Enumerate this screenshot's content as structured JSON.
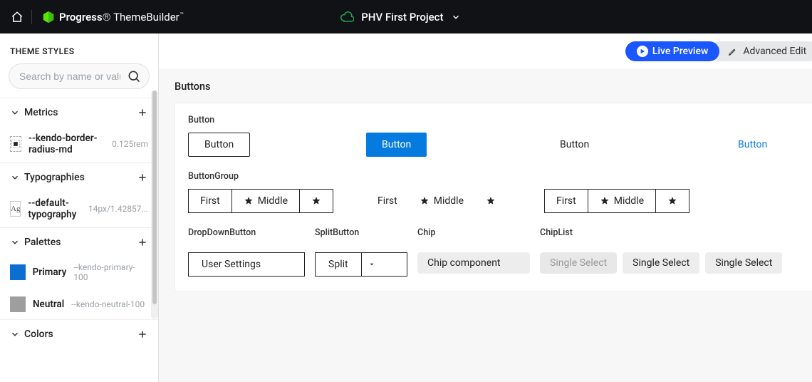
{
  "brand": {
    "company": "Progress",
    "product": "ThemeBuilder"
  },
  "project_name": "PHV First Project",
  "sidebar": {
    "title": "THEME STYLES",
    "search_placeholder": "Search by name or value",
    "sections": {
      "metrics": {
        "label": "Metrics",
        "items": [
          {
            "name": "--kendo-border-radius-md",
            "value": "0.125rem"
          }
        ]
      },
      "typographies": {
        "label": "Typographies",
        "items": [
          {
            "name": "--default-typography",
            "value": "14px/1.42857..."
          }
        ]
      },
      "palettes": {
        "label": "Palettes",
        "items": [
          {
            "name": "Primary",
            "token": "--kendo-primary-100"
          },
          {
            "name": "Neutral",
            "token": "--kendo-neutral-100"
          }
        ]
      },
      "colors": {
        "label": "Colors"
      }
    }
  },
  "toolbar": {
    "live_preview": "Live Preview",
    "advanced_edit": "Advanced Edit"
  },
  "canvas": {
    "section": "Buttons",
    "button_row": {
      "label": "Button",
      "text": "Button"
    },
    "button_group": {
      "label": "ButtonGroup",
      "first": "First",
      "middle": "Middle"
    },
    "dropdown": {
      "label": "DropDownButton",
      "text": "User Settings"
    },
    "split": {
      "label": "SplitButton",
      "text": "Split"
    },
    "chip": {
      "label": "Chip",
      "text": "Chip component"
    },
    "chiplist": {
      "label": "ChipList",
      "items": [
        "Single Select",
        "Single Select",
        "Single Select"
      ]
    }
  },
  "colors": {
    "primary": "#067bdf",
    "accent_blue": "#1b57ff",
    "cloud_green": "#1ea84c"
  }
}
